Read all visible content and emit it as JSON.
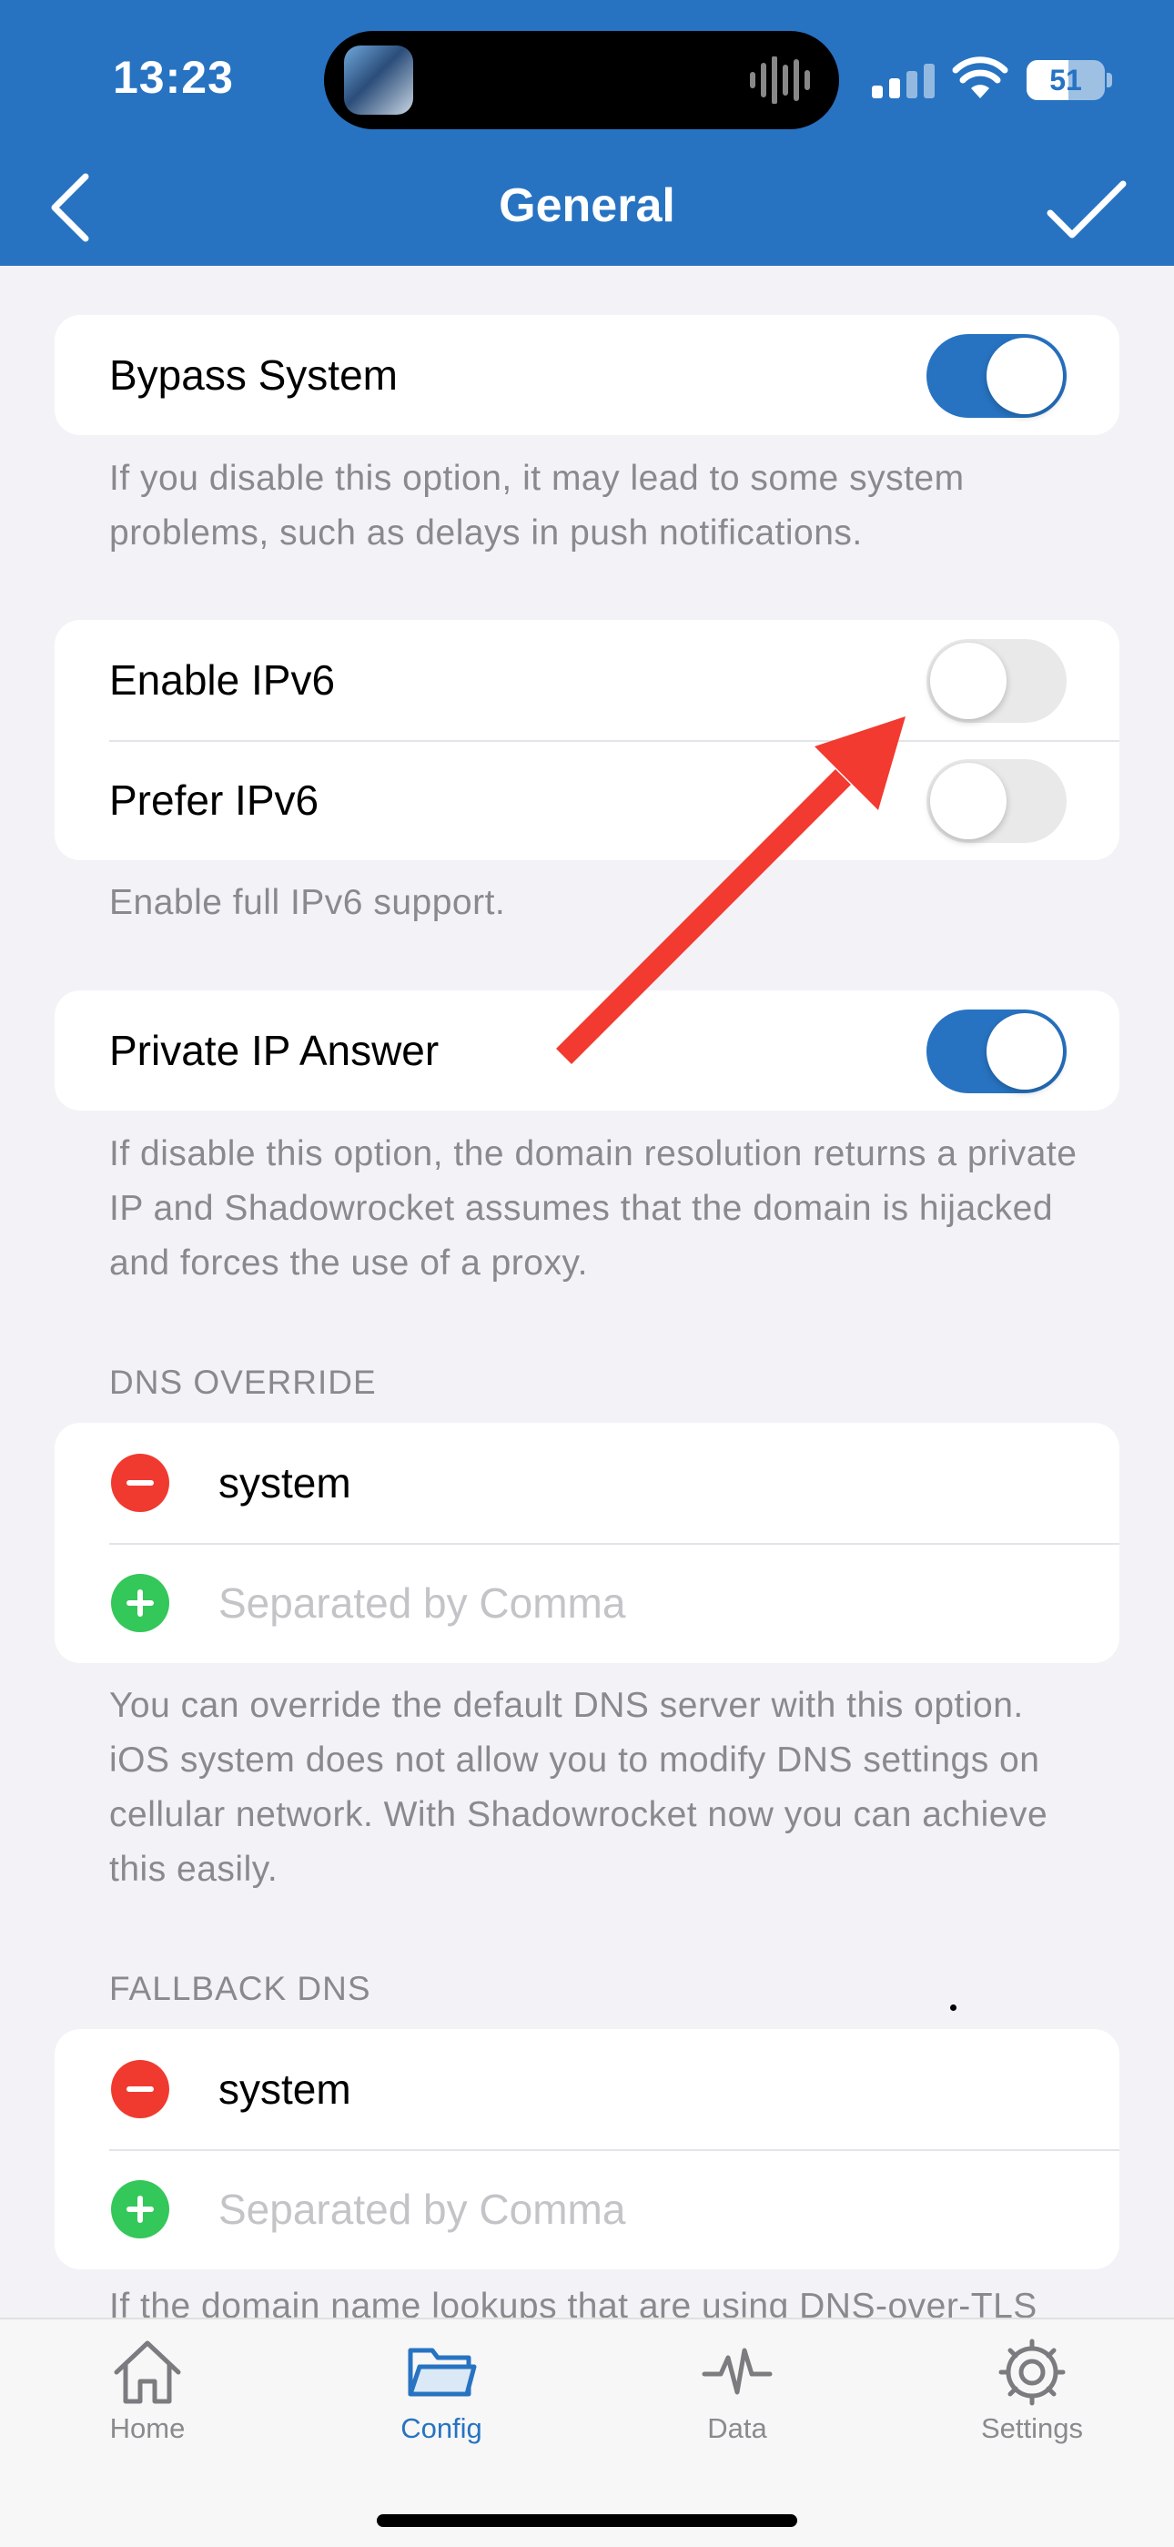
{
  "status_bar": {
    "time": "13:23",
    "battery": "51"
  },
  "nav": {
    "title": "General"
  },
  "bypass": {
    "label": "Bypass System",
    "enabled": true,
    "footer": "If you disable this option, it may lead to some system problems, such as delays in push notifications."
  },
  "ipv6": {
    "enable_label": "Enable IPv6",
    "enable_on": false,
    "prefer_label": "Prefer IPv6",
    "prefer_on": false,
    "footer": "Enable full IPv6 support."
  },
  "private_ip": {
    "label": "Private IP Answer",
    "enabled": true,
    "footer": "If disable this option, the domain resolution returns a private IP and Shadowrocket assumes that the domain is hijacked and forces the use of a proxy."
  },
  "dns_override": {
    "header": "DNS OVERRIDE",
    "entry": "system",
    "placeholder": "Separated by Comma",
    "footer": "You can override the default DNS server with this option. iOS system does not allow you to modify DNS settings on cellular network. With Shadowrocket now you can achieve this easily."
  },
  "fallback_dns": {
    "header": "FALLBACK DNS",
    "entry": "system",
    "placeholder": "Separated by Comma",
    "footer_partial": "If the domain name lookups that are using DNS-over-TLS"
  },
  "tabs": [
    {
      "label": "Home",
      "icon": "house-icon",
      "active": false
    },
    {
      "label": "Config",
      "icon": "folder-icon",
      "active": true
    },
    {
      "label": "Data",
      "icon": "pulse-icon",
      "active": false
    },
    {
      "label": "Settings",
      "icon": "gear-icon",
      "active": false
    }
  ],
  "colors": {
    "accent": "#2773c2",
    "background": "#f2f2f7",
    "remove": "#f03a30",
    "add": "#34c759",
    "annotation_arrow": "#f23a30"
  }
}
